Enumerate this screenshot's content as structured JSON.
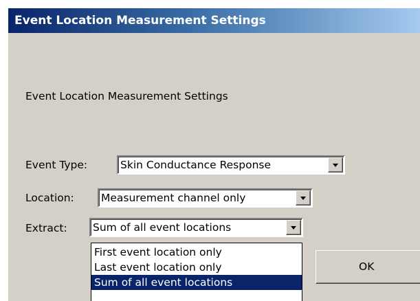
{
  "window": {
    "title": "Event Location Measurement Settings"
  },
  "dialog": {
    "heading": "Event Location Measurement Settings"
  },
  "event_type": {
    "label": "Event Type:",
    "value": "Skin Conductance Response"
  },
  "location": {
    "label": "Location:",
    "value": "Measurement channel only"
  },
  "extract": {
    "label": "Extract:",
    "value": "Sum of all event locations",
    "options": [
      "First event location only",
      "Last event location only",
      "Sum of all event locations"
    ],
    "selected_index": 2
  },
  "buttons": {
    "ok_label": "OK"
  },
  "icons": {
    "dropdown": "chevron-down-icon"
  },
  "colors": {
    "face": "#d4d0c8",
    "title_start": "#0a246a",
    "title_end": "#a6caf0",
    "selection": "#0a246a"
  }
}
